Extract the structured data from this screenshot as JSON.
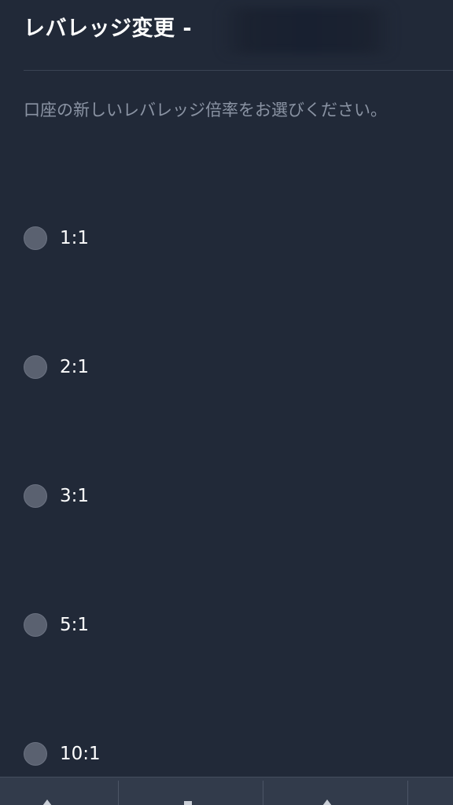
{
  "header": {
    "title": "レバレッジ変更 -"
  },
  "description": "口座の新しいレバレッジ倍率をお選びください。",
  "options": [
    {
      "label": "1:1"
    },
    {
      "label": "2:1"
    },
    {
      "label": "3:1"
    },
    {
      "label": "5:1"
    },
    {
      "label": "10:1"
    }
  ],
  "bottom_bar": {
    "icons": [
      "up-arrow-icon",
      "square-icon",
      "triangle-icon"
    ]
  },
  "colors": {
    "background": "#212938",
    "radio_fill": "#5a6170",
    "description_text": "#8a93a3"
  }
}
